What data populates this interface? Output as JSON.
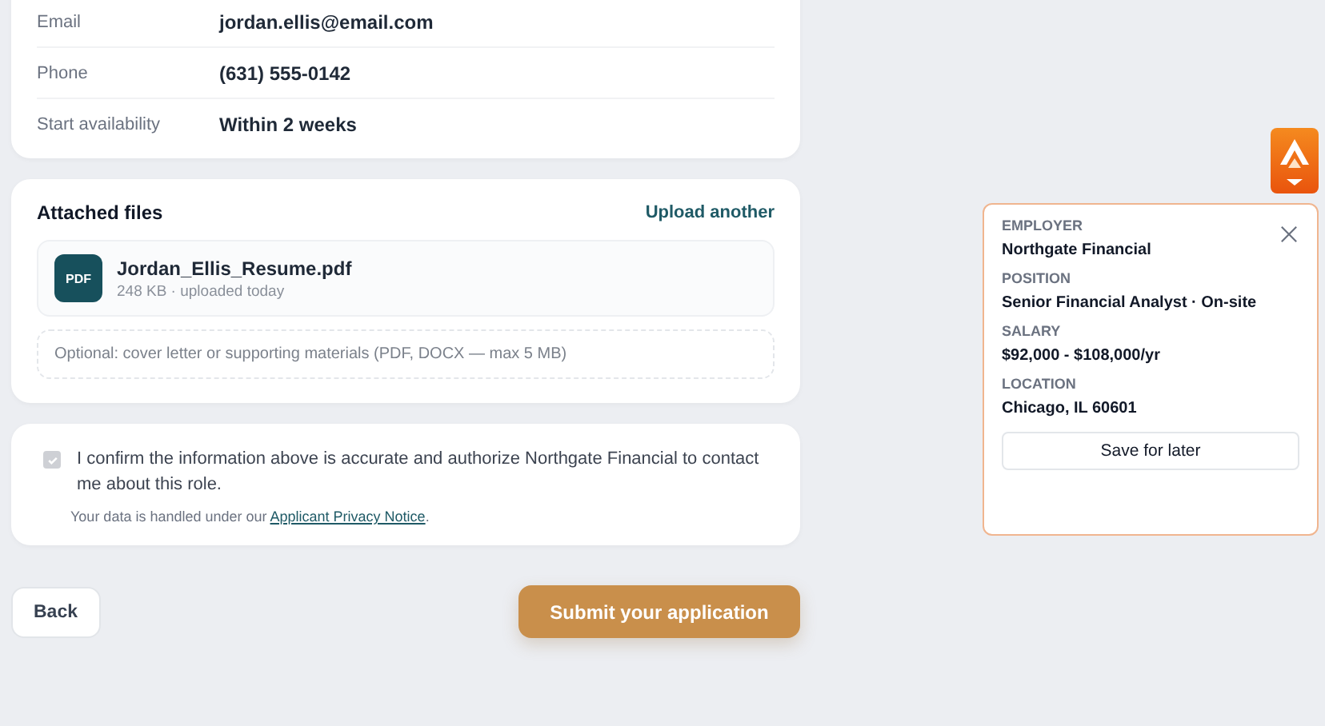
{
  "contact": [
    {
      "label": "Email",
      "value": "jordan.ellis@email.com"
    },
    {
      "label": "Phone",
      "value": "(631) 555-0142"
    },
    {
      "label": "Start availability",
      "value": "Within 2 weeks"
    }
  ],
  "attachments": {
    "title": "Attached files",
    "action": "Upload another",
    "files": [
      {
        "badge": "PDF",
        "name": "Jordan_Ellis_Resume.pdf",
        "meta": "248 KB · uploaded today"
      }
    ],
    "dropzone": "Optional: cover letter or supporting materials (PDF, DOCX — max 5 MB)"
  },
  "consent": {
    "checked": true,
    "disabled": true,
    "text": "I confirm the information above is accurate and authorize Northgate Financial to contact me about this role.",
    "note": "Your data is handled under our ",
    "link": "Applicant Privacy Notice",
    "note_end": "."
  },
  "buttons": {
    "back": "Back",
    "submit": "Submit your application"
  },
  "job_panel": {
    "fields": [
      {
        "label": "EMPLOYER",
        "value": "Northgate Financial"
      },
      {
        "label": "POSITION",
        "value": "Senior Financial Analyst · On-site"
      },
      {
        "label": "SALARY",
        "value": "$92,000 - $108,000/yr"
      },
      {
        "label": "LOCATION",
        "value": "Chicago, IL 60601"
      }
    ],
    "action": "Save for later"
  }
}
